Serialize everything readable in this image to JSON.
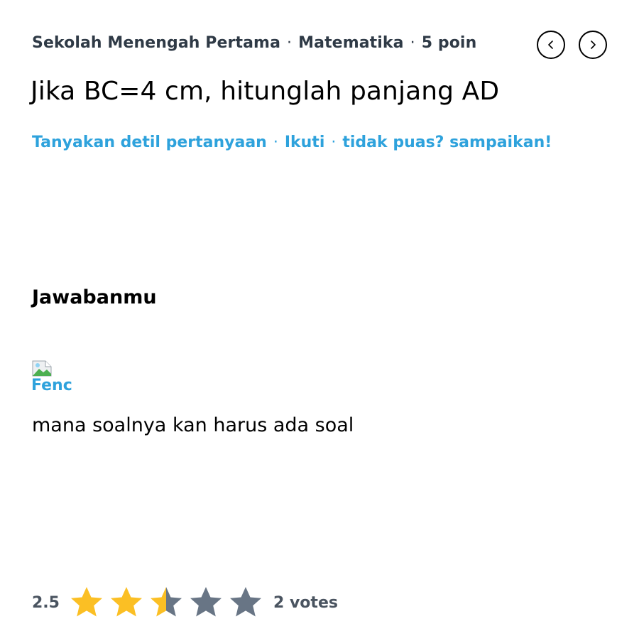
{
  "question": {
    "level": "Sekolah Menengah Pertama",
    "subject": "Matematika",
    "points": "5 poin",
    "separator": "·",
    "title": "Jika BC=4 cm, hitunglah panjang AD"
  },
  "actions": {
    "ask_detail": "Tanyakan detil pertanyaan",
    "follow": "Ikuti",
    "report": "tidak puas? sampaikan!"
  },
  "answer_section": {
    "heading": "Jawabanmu",
    "avatar_alt": "Fenc",
    "answer_text": "mana soalnya kan harus ada soal"
  },
  "rating": {
    "score": "2.5",
    "value": 2.5,
    "max": 5,
    "votes": "2 votes"
  },
  "colors": {
    "accent": "#2ea2dc",
    "star_filled": "#fbbf24",
    "star_empty": "#687585",
    "meta_text": "#2f3a46"
  },
  "icons": {
    "prev": "chevron-left-icon",
    "next": "chevron-right-icon",
    "broken_image": "broken-image-icon",
    "star": "star-icon"
  }
}
